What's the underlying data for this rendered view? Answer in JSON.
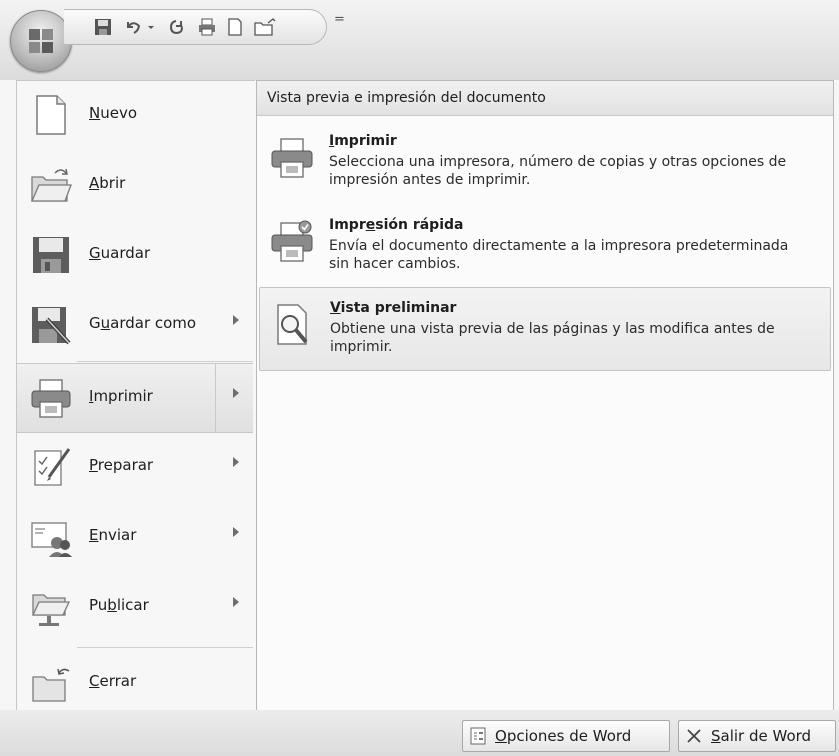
{
  "qat": {
    "icons": [
      "save-icon",
      "undo-icon",
      "undo-dropdown-icon",
      "redo-icon",
      "print-icon",
      "new-document-icon",
      "open-icon"
    ],
    "more_glyph": "="
  },
  "menu": {
    "items": [
      {
        "key": "nuevo",
        "pre": "",
        "u": "N",
        "post": "uevo",
        "icon": "new-document-icon",
        "has_arrow": false
      },
      {
        "key": "abrir",
        "pre": "",
        "u": "A",
        "post": "brir",
        "icon": "open-folder-icon",
        "has_arrow": false
      },
      {
        "key": "guardar",
        "pre": "",
        "u": "G",
        "post": "uardar",
        "icon": "save-disk-icon",
        "has_arrow": false
      },
      {
        "key": "guardar-como",
        "pre": "G",
        "u": "u",
        "post": "ardar como",
        "icon": "save-as-icon",
        "has_arrow": true
      },
      {
        "key": "imprimir",
        "pre": "",
        "u": "I",
        "post": "mprimir",
        "icon": "printer-icon",
        "has_arrow": true,
        "active": true
      },
      {
        "key": "preparar",
        "pre": "",
        "u": "P",
        "post": "reparar",
        "icon": "prepare-icon",
        "has_arrow": true
      },
      {
        "key": "enviar",
        "pre": "",
        "u": "E",
        "post": "nviar",
        "icon": "send-icon",
        "has_arrow": true
      },
      {
        "key": "publicar",
        "pre": "Pu",
        "u": "b",
        "post": "licar",
        "icon": "publish-icon",
        "has_arrow": true
      },
      {
        "key": "cerrar",
        "pre": "",
        "u": "C",
        "post": "errar",
        "icon": "close-document-icon",
        "has_arrow": false
      }
    ]
  },
  "panel": {
    "header": "Vista previa e impresión del documento",
    "items": [
      {
        "key": "imprimir",
        "pre": "",
        "u": "I",
        "post": "mprimir",
        "desc": "Selecciona una impresora, número de copias y otras opciones de impresión antes de imprimir.",
        "icon": "printer-icon"
      },
      {
        "key": "impresion-rapida",
        "pre": "Impr",
        "u": "e",
        "post": "sión rápida",
        "desc": "Envía el documento directamente a la impresora predeterminada sin hacer cambios.",
        "icon": "quick-print-icon"
      },
      {
        "key": "vista-preliminar",
        "pre": "",
        "u": "V",
        "post": "ista preliminar",
        "desc": "Obtiene una vista previa de las páginas y las modifica antes de imprimir.",
        "icon": "print-preview-icon",
        "highlighted": true
      }
    ]
  },
  "bottom": {
    "options": {
      "pre": "",
      "u": "O",
      "post": "pciones de Word"
    },
    "exit": {
      "pre": "",
      "u": "S",
      "post": "alir de Word"
    }
  }
}
